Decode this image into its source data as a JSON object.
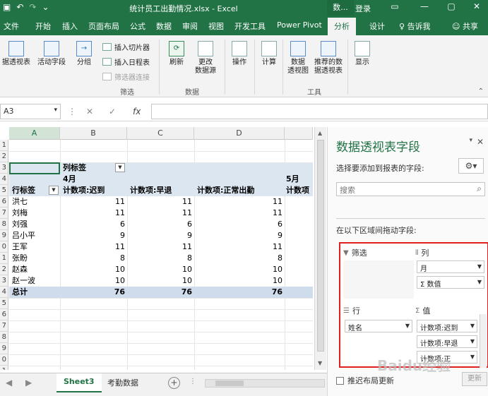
{
  "titlebar": {
    "title": "统计员工出勤情况.xlsx - Excel",
    "context_tab": "数...",
    "login": "登录",
    "qa_icons": [
      "save-icon",
      "undo-icon",
      "redo-icon",
      "customize-icon"
    ]
  },
  "tabs": {
    "items": [
      {
        "label": "文件"
      },
      {
        "label": "开始"
      },
      {
        "label": "插入"
      },
      {
        "label": "页面布局"
      },
      {
        "label": "公式"
      },
      {
        "label": "数据"
      },
      {
        "label": "审阅"
      },
      {
        "label": "视图"
      },
      {
        "label": "开发工具"
      },
      {
        "label": "Power Pivot"
      },
      {
        "label": "分析"
      },
      {
        "label": "设计"
      }
    ],
    "active": "分析",
    "tell_me": "告诉我",
    "share": "共享"
  },
  "ribbon": {
    "pivot_options": "据透视表",
    "active_field": "活动字段",
    "group": "分组",
    "insert_slicer": "插入切片器",
    "insert_timeline": "插入日程表",
    "filter_connections": "筛选器连接",
    "filter_group": "筛选",
    "refresh": "刷新",
    "change_source_1": "更改",
    "change_source_2": "数据源",
    "data_group": "数据",
    "actions": "操作",
    "calculations": "计算",
    "pivot_chart_1": "数据",
    "pivot_chart_2": "透视图",
    "recommended_1": "推荐的数",
    "recommended_2": "据透视表",
    "tools_group": "工具",
    "show": "显示"
  },
  "formula_bar": {
    "name_box": "A3",
    "fx": "fx",
    "value": ""
  },
  "grid": {
    "columns": [
      "A",
      "B",
      "C",
      "D"
    ],
    "rows": [
      "1",
      "2",
      "3",
      "4",
      "5",
      "6",
      "7",
      "8",
      "9",
      "0",
      "1",
      "2",
      "3",
      "4",
      "5",
      "6",
      "7",
      "8",
      "9",
      "0",
      "1"
    ],
    "col_label_header": "列标签",
    "row_label_header": "行标签",
    "month1": "4月",
    "month2": "5月",
    "headers": [
      "计数项:迟到",
      "计数项:早退",
      "计数项:正常出勤",
      "计数项"
    ],
    "data_rows": [
      {
        "name": "洪七",
        "values": [
          11,
          11,
          11
        ]
      },
      {
        "name": "刘梅",
        "values": [
          11,
          11,
          11
        ]
      },
      {
        "name": "刘强",
        "values": [
          6,
          6,
          6
        ]
      },
      {
        "name": "吕小平",
        "values": [
          9,
          9,
          9
        ]
      },
      {
        "name": "王军",
        "values": [
          11,
          11,
          11
        ]
      },
      {
        "name": "张盼",
        "values": [
          8,
          8,
          8
        ]
      },
      {
        "name": "赵森",
        "values": [
          10,
          10,
          10
        ]
      },
      {
        "name": "赵一波",
        "values": [
          10,
          10,
          10
        ]
      }
    ],
    "total": {
      "name": "总计",
      "values": [
        76,
        76,
        76
      ]
    }
  },
  "sheets": {
    "tabs": [
      "Sheet3",
      "考勤数据"
    ],
    "active": "Sheet3",
    "add": "+"
  },
  "pane": {
    "title": "数据透视表字段",
    "hint": "选择要添加到报表的字段:",
    "search_placeholder": "搜索",
    "drag_hint": "在以下区域间拖动字段:",
    "filters_label": "筛选",
    "columns_label": "列",
    "rows_label": "行",
    "values_label": "值",
    "column_fields": [
      "月",
      "数值"
    ],
    "row_fields": [
      "姓名"
    ],
    "value_fields": [
      "计数项:迟到",
      "计数项:早退",
      "计数项:正"
    ],
    "defer_label": "推迟布局更新",
    "update_button": "更新"
  },
  "watermark": "Baidu经验",
  "colors": {
    "accent": "#217346",
    "pivot_band": "#dce6f1",
    "highlight_border": "#e02020"
  }
}
